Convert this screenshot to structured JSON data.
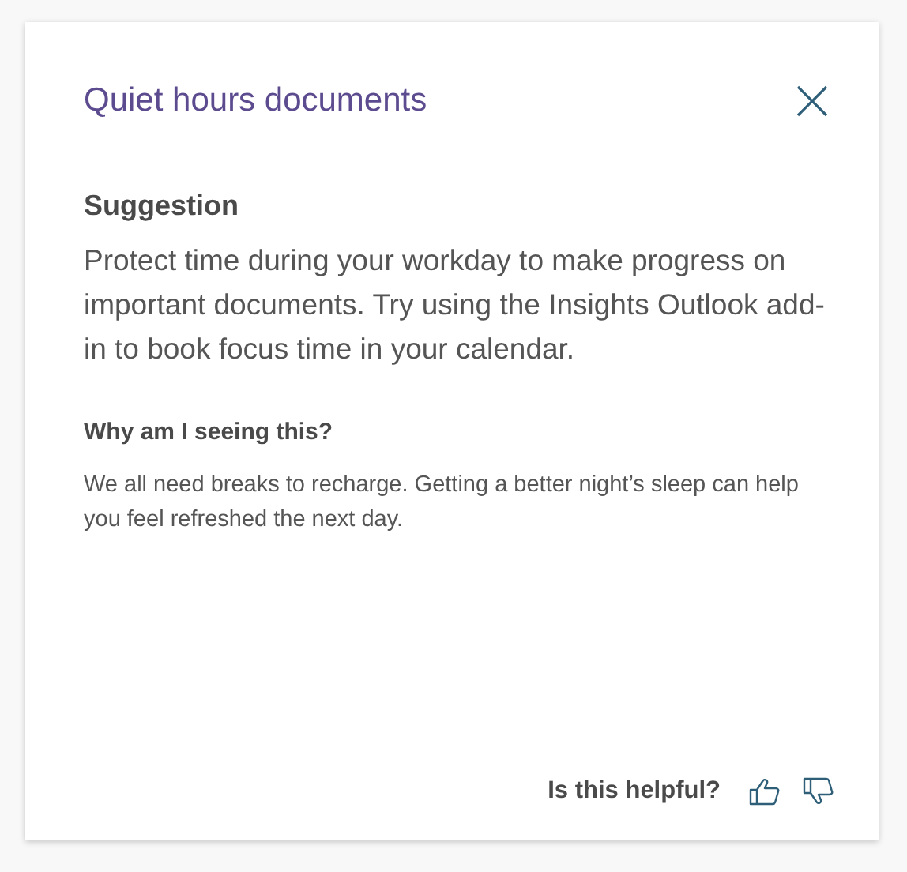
{
  "card": {
    "title": "Quiet hours documents",
    "section_heading": "Suggestion",
    "suggestion": "Protect time during your workday to make progress on important documents. Try using the Insights Outlook add-in to book focus time in your calendar.",
    "reason_heading": "Why am I seeing this?",
    "reason": "We all need breaks to recharge. Getting a better night’s sleep can help you feel refreshed the next day.",
    "feedback_prompt": "Is this helpful?"
  }
}
